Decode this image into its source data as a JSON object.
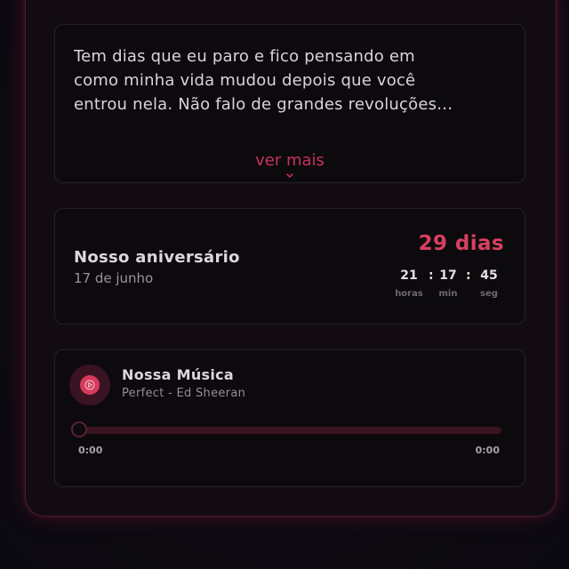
{
  "letter": {
    "lines": [
      "Tem dias que eu paro e fico pensando em",
      "como minha vida mudou depois que você",
      "entrou nela. Não falo de grandes revoluções…"
    ],
    "see_more_label": "ver mais",
    "chevron_icon": "chevron-down-icon"
  },
  "anniversary": {
    "title": "Nosso aniversário",
    "date": "17 de junho",
    "days": "29 dias",
    "countdown": {
      "hours": "21",
      "minutes": "17",
      "seconds": "45",
      "separator": ":",
      "hours_label": "horas",
      "minutes_label": "min",
      "seconds_label": "seg"
    }
  },
  "music": {
    "title": "Nossa Música",
    "artist": "Perfect - Ed Sheeran",
    "current_time": "0:00",
    "total_time": "0:00",
    "progress": 0,
    "play_icon": "play-icon"
  },
  "colors": {
    "accent": "#d8405f",
    "background": "#0d0910",
    "card": "#0c0a0d",
    "border_glow": "#4a1a33"
  }
}
